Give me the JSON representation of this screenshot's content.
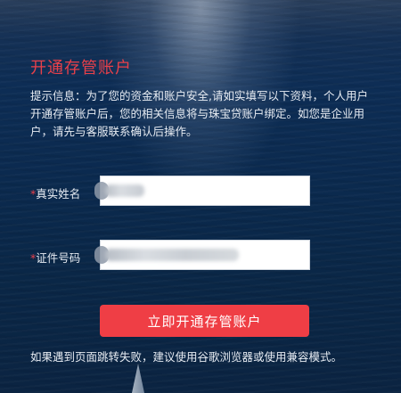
{
  "form": {
    "title": "开通存管账户",
    "tip": "提示信息：为了您的资金和账户安全,请如实填写以下资料，个人用户开通存管账户后，您的相关信息将与珠宝贷账户绑定。如您是企业用户，请先与客服联系确认后操作。",
    "fields": [
      {
        "required_mark": "*",
        "label": "真实姓名",
        "value": ""
      },
      {
        "required_mark": "*",
        "label": "证件号码",
        "value": ""
      }
    ],
    "submit_label": "立即开通存管账户",
    "note": "如果遇到页面跳转失败，建议使用谷歌浏览器或使用兼容模式。"
  },
  "colors": {
    "accent": "#ef3e45",
    "title": "#e8404a",
    "background": "#0b2a4a"
  }
}
